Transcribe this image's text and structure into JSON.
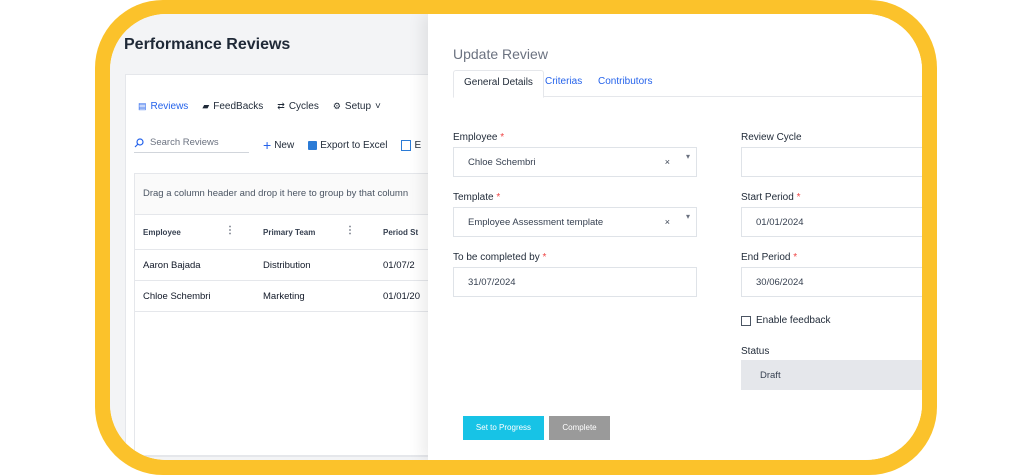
{
  "page": {
    "title": "Performance Reviews"
  },
  "nav": [
    {
      "label": "Reviews",
      "icon": "document-icon",
      "active": true
    },
    {
      "label": "FeedBacks",
      "icon": "chat-icon",
      "active": false
    },
    {
      "label": "Cycles",
      "icon": "cycle-icon",
      "active": false
    },
    {
      "label": "Setup",
      "icon": "gear-icon",
      "active": false,
      "suffix": "˅"
    }
  ],
  "toolbar": {
    "search_placeholder": "Search Reviews",
    "new_label": "New",
    "export_label": "Export to Excel",
    "extra_label": "E"
  },
  "grid": {
    "group_hint": "Drag a column header and drop it here to group by that column",
    "columns": [
      "Employee",
      "Primary Team",
      "Period St"
    ],
    "rows": [
      [
        "Aaron Bajada",
        "Distribution",
        "01/07/2"
      ],
      [
        "Chloe Schembri",
        "Marketing",
        "01/01/20"
      ]
    ]
  },
  "drawer": {
    "title": "Update Review",
    "tabs": [
      "General Details",
      "Criterias",
      "Contributors"
    ],
    "employee": {
      "label": "Employee",
      "value": "Chloe Schembri"
    },
    "template": {
      "label": "Template",
      "value": "Employee Assessment template"
    },
    "completed_by": {
      "label": "To be completed by",
      "value": "31/07/2024"
    },
    "review_cycle": {
      "label": "Review Cycle",
      "value": ""
    },
    "start_period": {
      "label": "Start Period",
      "value": "01/01/2024"
    },
    "end_period": {
      "label": "End Period",
      "value": "30/06/2024"
    },
    "enable_feedback": {
      "label": "Enable feedback",
      "checked": false
    },
    "status": {
      "label": "Status",
      "value": "Draft"
    },
    "buttons": {
      "primary": "Set to Progress",
      "secondary": "Complete"
    },
    "required_mark": "*",
    "clear_glyph": "×",
    "dropdown_glyph": "▾"
  },
  "colors": {
    "frame": "#fbc22b",
    "accent": "#2563eb",
    "primary_button": "#17c3e6",
    "required": "#ef4444"
  }
}
